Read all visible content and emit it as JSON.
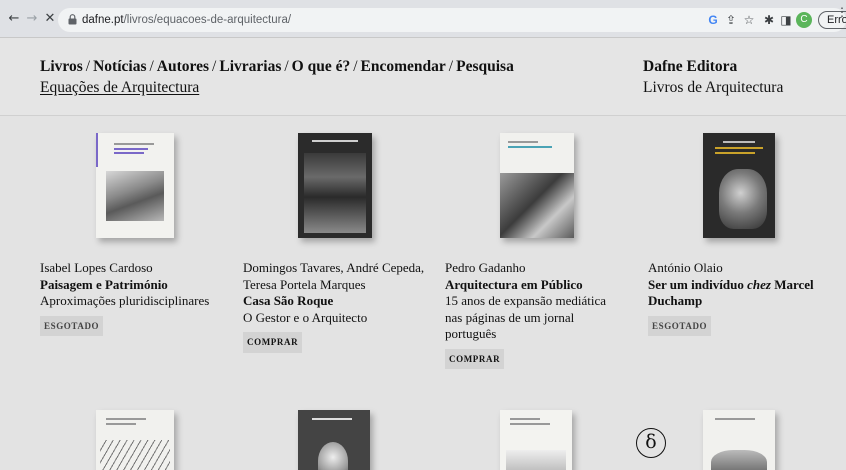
{
  "browser": {
    "url_host": "dafne.pt",
    "url_path": "/livros/equacoes-de-arquitectura/",
    "profile_letter": "C",
    "error_label": "Erro"
  },
  "site": {
    "menu": [
      "Livros",
      "Notícias",
      "Autores",
      "Livrarias",
      "O que é?",
      "Encomendar",
      "Pesquisa"
    ],
    "current_collection": "Equações de Arquitectura",
    "brand_name": "Dafne Editora",
    "brand_subtitle": "Livros de Arquitectura"
  },
  "books": [
    {
      "author": "Isabel Lopes Cardoso",
      "title": "Paisagem e Património",
      "subtitle": "Aproximações pluridisciplinares",
      "status": "ESGOTADO",
      "cover": {
        "bg": "#f2f2ef",
        "accent": "#7a68c8",
        "cover_title": "Paisagem e Património"
      }
    },
    {
      "author": "Domingos Tavares, André Cepeda, Teresa Portela Marques",
      "title": "Casa São Roque",
      "subtitle": "O Gestor e o Arquitecto",
      "status": "COMPRAR",
      "cover": {
        "bg": "#2b2b2b",
        "accent": "#cfcfcf",
        "cover_title": "Casa São Roque"
      }
    },
    {
      "author": "Pedro Gadanho",
      "title": "Arquitectura em Público",
      "subtitle": "15 anos de expansão mediática nas páginas de um jornal português",
      "status": "COMPRAR",
      "cover": {
        "bg": "#f1f1ee",
        "accent": "#4aa3b5",
        "cover_title": "Arquitectura em Público"
      }
    },
    {
      "author": "António Olaio",
      "title_pre": "Ser um indivíduo ",
      "title_em": "chez",
      "title_post": " Marcel Duchamp",
      "status": "ESGOTADO",
      "cover": {
        "bg": "#2a2a2a",
        "accent": "#c9a22a",
        "cover_title": "Ser um indivíduo chez Marcel Duchamp"
      }
    }
  ],
  "next_row_covers": [
    "#f1f1ee",
    "#444444",
    "#f3f3f0",
    "#f1f1ee"
  ],
  "delta_symbol": "δ"
}
